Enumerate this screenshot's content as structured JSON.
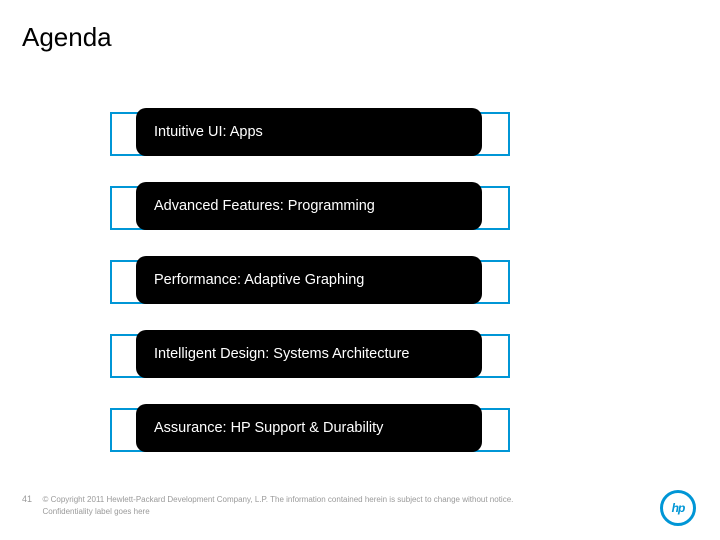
{
  "title": "Agenda",
  "agenda": {
    "items": [
      {
        "label": "Intuitive UI: Apps"
      },
      {
        "label": "Advanced Features: Programming"
      },
      {
        "label": "Performance: Adaptive Graphing"
      },
      {
        "label": "Intelligent Design: Systems Architecture"
      },
      {
        "label": "Assurance: HP Support & Durability"
      }
    ]
  },
  "footer": {
    "page": "41",
    "copyright": "© Copyright 2011 Hewlett-Packard Development Company, L.P. The information contained herein is subject to change without notice. Confidentiality label goes here"
  },
  "brand": {
    "logo_name": "hp-logo",
    "logo_text": "hp",
    "accent_color": "#0096d6"
  }
}
